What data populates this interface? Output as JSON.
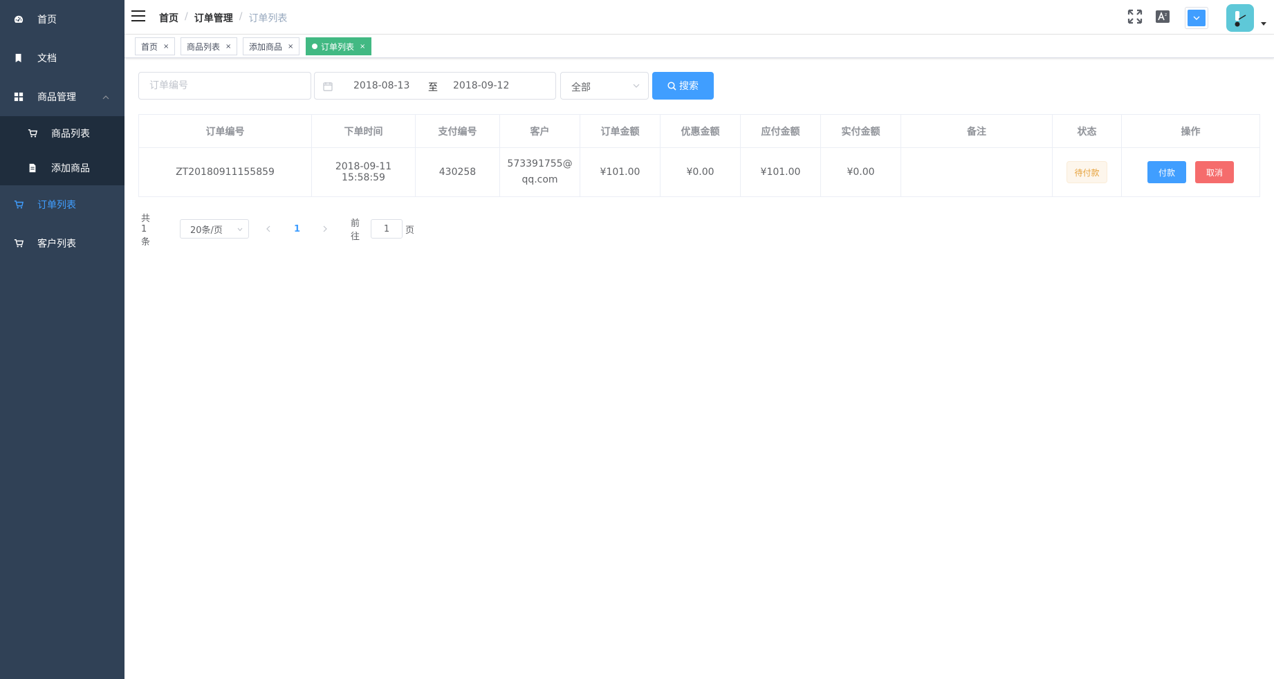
{
  "sidebar": {
    "items": [
      {
        "label": "首页",
        "icon": "dashboard-icon"
      },
      {
        "label": "文档",
        "icon": "document-icon"
      },
      {
        "label": "商品管理",
        "icon": "grid-icon"
      },
      {
        "label": "订单列表",
        "icon": "cart-icon"
      },
      {
        "label": "客户列表",
        "icon": "cart-icon"
      }
    ],
    "submenu": [
      {
        "label": "商品列表",
        "icon": "cart-icon"
      },
      {
        "label": "添加商品",
        "icon": "file-icon"
      }
    ],
    "active_color": "#409eff",
    "bg_color": "#304156"
  },
  "breadcrumb": {
    "home": "首页",
    "parent": "订单管理",
    "current": "订单列表"
  },
  "tags": [
    {
      "label": "首页"
    },
    {
      "label": "商品列表"
    },
    {
      "label": "添加商品"
    },
    {
      "label": "订单列表"
    }
  ],
  "tag_close": "×",
  "filters": {
    "order_no_placeholder": "订单编号",
    "date_start": "2018-08-13",
    "date_sep": "至",
    "date_end": "2018-09-12",
    "status_selected": "全部",
    "search_label": "搜索"
  },
  "table": {
    "columns": [
      "订单编号",
      "下单时间",
      "支付编号",
      "客户",
      "订单金额",
      "优惠金额",
      "应付金额",
      "实付金额",
      "备注",
      "状态",
      "操作"
    ],
    "rows": [
      {
        "order_no": "ZT20180911155859",
        "created_at": "2018-09-11 15:58:59",
        "pay_no": "430258",
        "customer": "573391755@qq.com",
        "order_amount": "¥101.00",
        "discount": "¥0.00",
        "payable": "¥101.00",
        "paid": "¥0.00",
        "remark": "",
        "status": "待付款",
        "pay_label": "付款",
        "cancel_label": "取消"
      }
    ]
  },
  "pagination": {
    "total_text": "共 1 条",
    "page_size": "20条/页",
    "current_page": "1",
    "goto_label": "前往",
    "goto_value": "1",
    "page_suffix": "页"
  }
}
